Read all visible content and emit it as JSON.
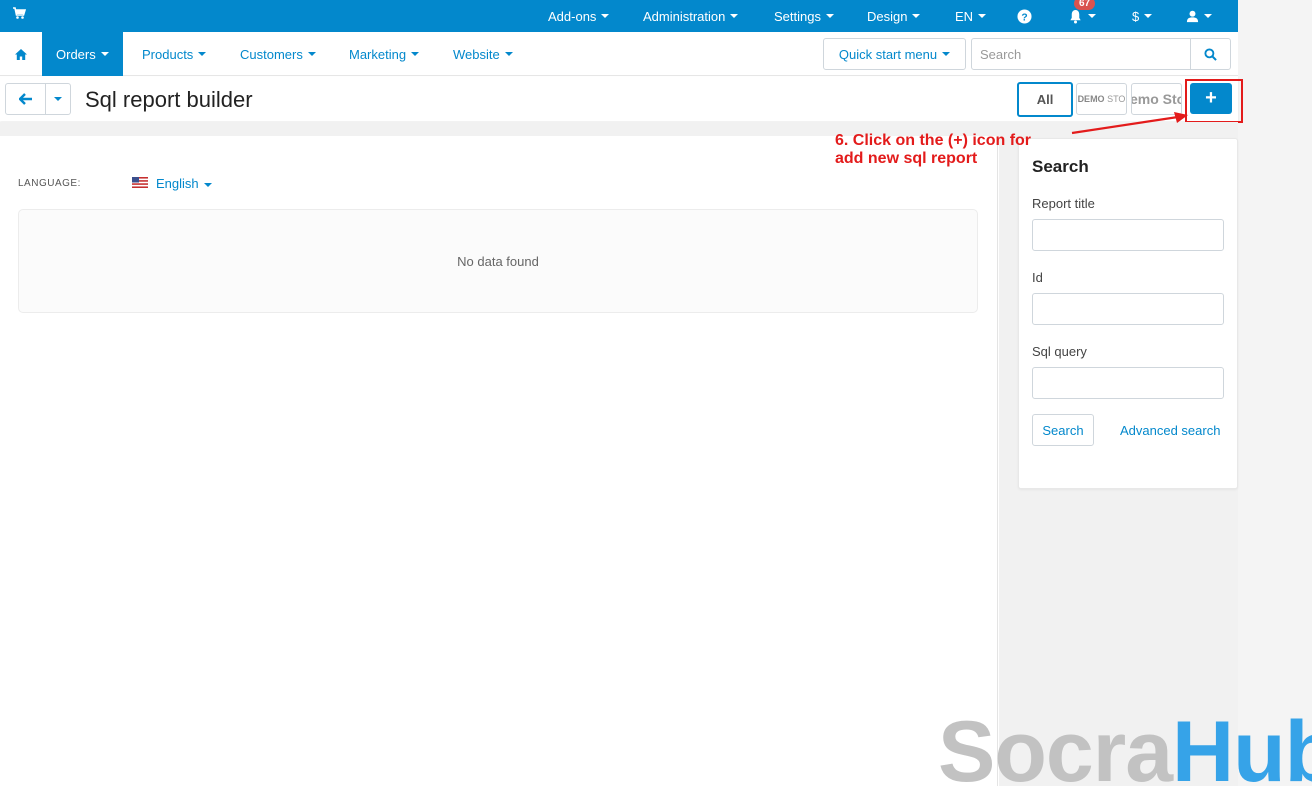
{
  "topbar": {
    "menus": [
      "Add-ons",
      "Administration",
      "Settings",
      "Design",
      "EN"
    ],
    "notification_count": "67",
    "currency": "$"
  },
  "nav": {
    "items": [
      "Orders",
      "Products",
      "Customers",
      "Marketing",
      "Website"
    ],
    "quick_start": "Quick start menu",
    "search_placeholder": "Search"
  },
  "titlebar": {
    "title": "Sql report builder",
    "all_label": "All",
    "store1_label_a": "DEMO",
    "store1_label_b": "STO",
    "store2_label": "emo Sto",
    "add_label": "+"
  },
  "content": {
    "language_label": "LANGUAGE:",
    "language_value": "English",
    "no_data": "No data found"
  },
  "sidebar": {
    "title": "Search",
    "fields": [
      {
        "label": "Report title",
        "value": ""
      },
      {
        "label": "Id",
        "value": ""
      },
      {
        "label": "Sql query",
        "value": ""
      }
    ],
    "search_button": "Search",
    "advanced_link": "Advanced search"
  },
  "annotation": {
    "line1": "6. Click on the (+) icon for",
    "line2": "add new sql report"
  },
  "watermark": {
    "part1": "Socra",
    "part2": "Hub"
  },
  "colors": {
    "brand_blue": "#0388cc",
    "annotation_red": "#e31b1b"
  }
}
